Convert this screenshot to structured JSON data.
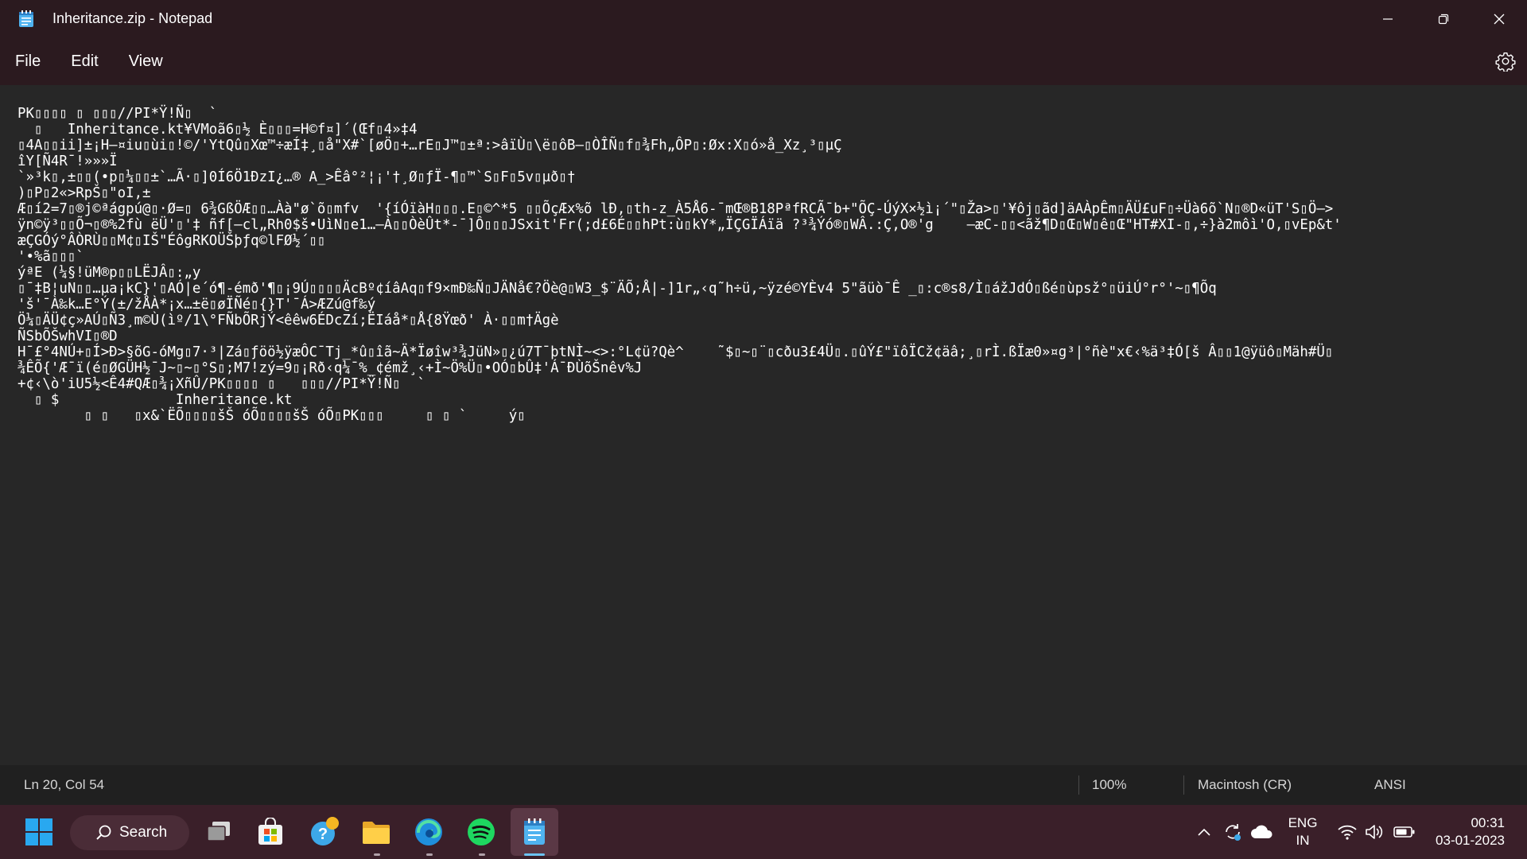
{
  "window": {
    "title": "Inheritance.zip - Notepad"
  },
  "menu": {
    "file": "File",
    "edit": "Edit",
    "view": "View"
  },
  "editor": {
    "content": "PK\u0003\u0004\u0014\u0000 \u0000 \u0000\b\u0000//PI*Ÿ!Ñ\u0000  `\n  \u0000   Inheritance.kt¥VMoã6\u0010½ È\u0000\u0000\u0000=H©f¤]´(Œf\u00104»‡4\n\u00104A\u0000\u0000ii]±¡H–¤iu\u0000ùi\u0000!©/'YtQû\u0000Xœ™÷æÍ‡¸\u0000å\"X#`[øÖ\u0000+…rE\u0000J™\u0000±ª:>âïÙ\u0000\\ë\u0000ôB–\u0000ÒÎÑ\u0000f\u0000¾Fh„ÔP\u0000:Øx:X\u0000ó»å_Xz¸³\u0000µÇ\nîY[Ñ4R¯!»»»Ï\n`»³k\u0000,±\u0000\u0000(•p\u0000¼\u0000\u0000±`…Ã·\u0000]0Í6Ö1ÐzI¿…® A_>Êâ°²¦¡'†¸Ø\u0000ƒÏ-¶\u0000™`S\u0000F\u00005v\u0000µð\u0000†\n)\u0000P\u00002«>RpŠ\u0000\"oI,±\nÆ\u0000í2=7\u0000®j©ªágpú@\u0000·Ø=\u0000 6¾GßÖÆ\u0000\u0000…Àà\"ø`õ\u0000mfv  '{íÓïàH\u0000\u0000\u0000.E\u0000©^*5 \u0000\u0000ÕçÆx%õ lÐ,\u0000th-z_À5Å6-¯mŒ®B18PªfRCÃ¯b+\"ÕÇ-ÚýX×½ì¡´\"\u0000Ža>\u0000'¥ôj\u0000ãd]äAÀpÊm\u0000ÄÜ£uF\u0000÷Üà6õ`N\u0000®D«üT'S\u0000Ö–>\nÿn©ÿ³\u0000\u0000Õ¬\u0000®%2fù ëÜ'\u0000'‡ ñf[–cl„Rh0$š•UìN\u0000e1…–À\u0000\u0000ÒèÛt*-¯]Ô\u0000\u0000\u0000JSxit'Fr(;d£6É\u0000\u0000hPt:ù\u0000kY*„ÏÇGÏÁïä ?³¾Ýó®\u0000WÂ.:Ç,O®'g    –æC-\u0000\u0000<ãž¶D\u0000Œ\u0000W\u0000ê\u0000Œ\"HT#XI-\u0000,÷}à2môì'O,\u0000vEp&t'\næÇGÓý°ÂÒRÙ\u0000\u0000M¢\u0000IŠ\"ÉôgRKOÜŠþƒq©lFØ½´\u0000\u0000\n'•%ã\u0000\u0000\u0000`\nýªE (¼§!üM®p\u0000\u0000LËJÂ\u0000:„y\n\u0000¯‡B¦uN\u0000\u0000…µa¡kC}'\u0000AÓ|e´ó¶-émð'¶\u0000¡9Ú\u0000\u0000\u0000\u0000ÄcBº¢íâAq\u0000f9×mÐ‰Ñ\u0000JÄNå€?Öè@\u0000W3_$¨ÄÕ;Å|-]1r„‹q˜h÷ü,~ÿzé©YÈv4 5\"ãüò¯Ê _\u0000:c®s8/Ì\u0000ážJdÓ\u0000ßé\u0000ùpsž°\u0000üiÚ°r°'~\u0000¶Õq\n'š'¯À‰k…E°Ý(±/žÅÀ*¡x…±ë\u0000øÏÑé\u0000{}T'¯Á>ÆZú@f‰ý\nÖ¼\u0000ÄÜ¢ç»AÚ\u0000Ñ3¸m©Ù(ìº/1\\°FÑbÕRjÝ<êêw6ÉDcZí;ËIáå*\u0000Å{8Ÿœð' À·\u0000\u0000m†Ägè\nÑSbÕŠwhVI\u0000®D\nH¯£°4NÚ+\u0000Í>Ð>§õG-óMg\u00007·³|Zá\u0000ƒöö½ÿæÔC¯Tj_*û\u0000îã~Ä*Ïøîw³¾JüN»\u0000¿ú7T¯þtNÌ~<>:°L¢ü?Qè^    ˜$\u0000~\u0000¨\u0000cðu3£4Ü\u0000.\u0000ûÝ£\"ïôÏCž¢äâ;¸\u0000rÌ.ßÏæ0»¤g³|°ñè\"x€‹%ä³‡Ó[š Â\u0000\u00001@ÿüô\u0000Mäh#Ü\u0000\n¾ÊÕ{'Æ¯ï(é\u0000ØGÜH½¯J~\u0000~\u0000°S\u0000;M7!zý=9\u0000¡Rð‹q¼¯%_¢émž¸‹+Ì~Ö%Ü\u0000•OÓ\u0000bÛ‡'Á¯ÐÙõŠnêv%J\n+¢‹\\ò'iU5½<Ê4#QÆ\u0000¾¡XñÛ/PK\u0001\u0002\u0014\u0000 \u0000   \u0000\b\u0000//PI*Ÿ!Ñ\u0000  `\n  \u0000 $              Inheritance.kt\n        \u0000 \u0000   \u0000x&`ËÕ\u0000\u0000\u0000\u0000šŠ óÕ\u0000\u0000\u0000\u0000šŠ óÕ\u0000PK\u0005\u0006\u0000     \u0000 \u0000 `     ý\u0000"
  },
  "status": {
    "position": "Ln 20, Col 54",
    "zoom": "100%",
    "line_ending": "Macintosh (CR)",
    "encoding": "ANSI"
  },
  "taskbar": {
    "search_label": "Search",
    "lang_top": "ENG",
    "lang_bottom": "IN",
    "time": "00:31",
    "date": "03-01-2023"
  }
}
